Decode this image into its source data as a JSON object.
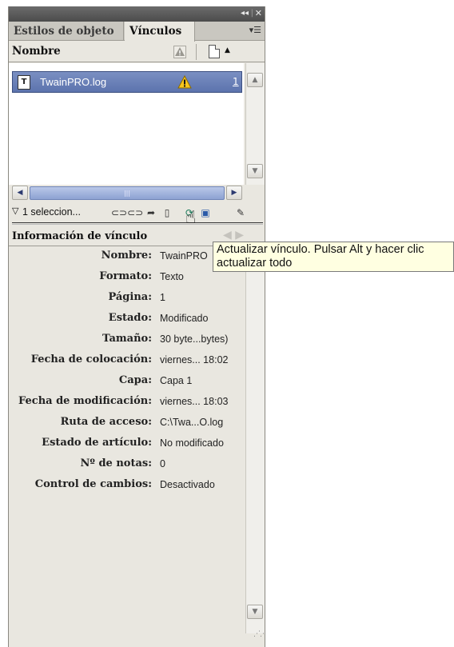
{
  "titlebar": {
    "collapse_icon": "double-chevron-icon",
    "close_icon": "close-icon",
    "collapse_glyph": "◂◂",
    "separator": "|",
    "close_glyph": "✕"
  },
  "tabs": [
    {
      "label": "Estilos de objeto",
      "active": false
    },
    {
      "label": "Vínculos",
      "active": true
    }
  ],
  "panel_menu_icon": "panel-menu-icon",
  "columns": {
    "name_label": "Nombre",
    "status_icon": "warning-icon",
    "page_icon": "page-icon",
    "sort_icon": "sort-up-icon"
  },
  "links": [
    {
      "file_icon": "text-file-icon",
      "file_icon_glyph": "T",
      "name": "TwainPRO.log",
      "status": "warning",
      "status_glyph": "⚠",
      "page": "1"
    }
  ],
  "toolbar": {
    "selection_text": "1 seleccion...",
    "selection_icon": "triangle-down-icon",
    "buttons": [
      "relink-icon",
      "goto-link-icon",
      "update-link-icon",
      "edit-original-icon"
    ]
  },
  "info": {
    "title": "Información de vínculo",
    "rows": [
      {
        "label": "Nombre:",
        "value": "TwainPRO"
      },
      {
        "label": "Formato:",
        "value": "Texto"
      },
      {
        "label": "Página:",
        "value": "1"
      },
      {
        "label": "Estado:",
        "value": "Modificado"
      },
      {
        "label": "Tamaño:",
        "value": "30 byte...bytes)"
      },
      {
        "label": "Fecha de colocación:",
        "value": "viernes... 18:02"
      },
      {
        "label": "Capa:",
        "value": "Capa 1"
      },
      {
        "label": "Fecha de modificación:",
        "value": "viernes... 18:03"
      },
      {
        "label": "Ruta de acceso:",
        "value": "C:\\Twa...O.log"
      },
      {
        "label": "Estado de artículo:",
        "value": "No modificado"
      },
      {
        "label": "Nº de notas:",
        "value": "0"
      },
      {
        "label": "Control de cambios:",
        "value": "Desactivado"
      }
    ]
  },
  "tooltip": {
    "text": "Actualizar vínculo. Pulsar Alt y hacer clic actualizar todo"
  },
  "cursor_icon": "hand-pointer-icon"
}
